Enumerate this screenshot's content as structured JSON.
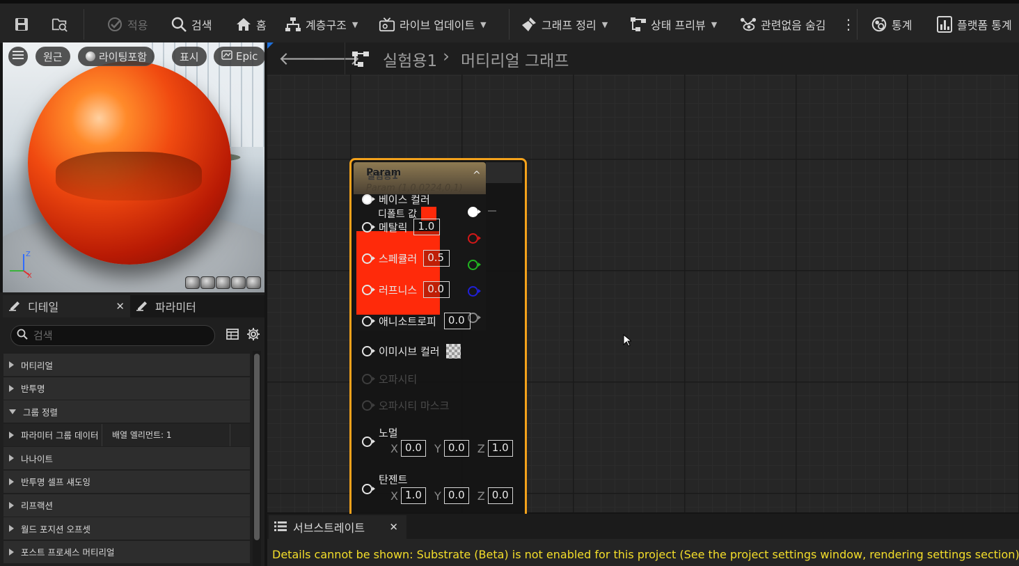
{
  "toolbar": {
    "apply_label": "적용",
    "browse_label": "검색",
    "home_label": "홈",
    "hierarchy_label": "계층구조",
    "live_update_label": "라이브 업데이트",
    "clean_graph_label": "그래프 정리",
    "preview_state_label": "상태 프리뷰",
    "hide_unrelated_label": "관련없음 숨김",
    "stats_label": "통계",
    "platform_stats_label": "플랫폼 통계"
  },
  "viewport": {
    "pill_original": "원근",
    "pill_lighting": "라이팅포함",
    "pill_show": "표시",
    "pill_epic": "Epic",
    "axis_z": "Z",
    "axis_x": "X"
  },
  "details": {
    "tab_details": "디테일",
    "tab_parameters": "파라미터",
    "search_placeholder": "검색",
    "categories": [
      {
        "label": "머티리얼",
        "open": false
      },
      {
        "label": "반투명",
        "open": false
      },
      {
        "label": "그룹 정렬",
        "open": true
      },
      {
        "label": "파라미터 그룹 데이터",
        "value": "배열 엘리먼트: 1",
        "sub": true
      },
      {
        "label": "나나이트",
        "open": false
      },
      {
        "label": "반투명 셀프 섀도잉",
        "open": false
      },
      {
        "label": "리프랙션",
        "open": false
      },
      {
        "label": "월드 포지션 오프셋",
        "open": false
      },
      {
        "label": "포스트 프로세스 머티리얼",
        "open": false
      }
    ]
  },
  "graph": {
    "breadcrumb_asset": "실험용1",
    "breadcrumb_sep": "›",
    "breadcrumb_graph": "머티리얼 그래프"
  },
  "node": {
    "title_back": "실험용1",
    "title_front": "Param",
    "subtitle": "Param (1,0.0224,0,1)",
    "default_value_label": "디폴트 값",
    "base_color": "베이스 컬러",
    "metallic": "메탈릭",
    "metallic_value": "1.0",
    "specular": "스페큘러",
    "specular_value": "0.5",
    "roughness": "러프니스",
    "roughness_value": "0.0",
    "anisotropy": "애니소트로피",
    "anisotropy_value": "0.0",
    "emissive": "이미시브 컬러",
    "opacity": "오파시티",
    "opacity_mask": "오파시티 마스크",
    "normal": "노멀",
    "normal_x": "0.0",
    "normal_y": "0.0",
    "normal_z": "1.0",
    "tangent": "탄젠트",
    "tangent_x": "1.0",
    "tangent_y": "0.0",
    "tangent_z": "0.0",
    "lbl_x": "X",
    "lbl_y": "Y",
    "lbl_z": "Z",
    "param_color": "#ff2a0a"
  },
  "substrate": {
    "tab_label": "서브스트레이트",
    "message": "Details cannot be shown: Substrate (Beta) is not enabled for this project (See the project settings window, rendering settings section)."
  },
  "colors": {
    "accent": "#f4a21b",
    "warning_text": "#f5df2a"
  }
}
